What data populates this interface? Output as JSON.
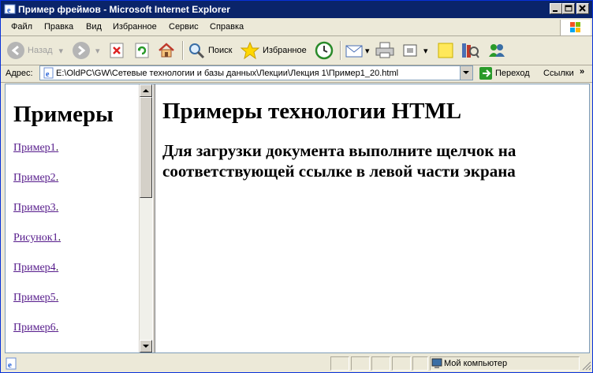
{
  "window": {
    "title": "Пример фреймов - Microsoft Internet Explorer"
  },
  "menu": {
    "items": [
      "Файл",
      "Правка",
      "Вид",
      "Избранное",
      "Сервис",
      "Справка"
    ],
    "accel": [
      "Ф",
      "П",
      "В",
      "И",
      "С",
      "С"
    ]
  },
  "toolbar": {
    "back_label": "Назад",
    "search_label": "Поиск",
    "favorites_label": "Избранное"
  },
  "address": {
    "label": "Адрес:",
    "url": "E:\\OldPC\\GW\\Сетевые технологии и базы данных\\Лекции\\Лекция 1\\Пример1_20.html",
    "go_label": "Переход",
    "links_label": "Ссылки"
  },
  "left_frame": {
    "heading": "Примеры",
    "links": [
      "Пример1",
      "Пример2",
      "Пример3",
      "Рисунок1",
      "Пример4",
      "Пример5",
      "Пример6"
    ],
    "link_color": "#551a8b"
  },
  "right_frame": {
    "heading": "Примеры технологии HTML",
    "subheading": "Для загрузки документа выполните щелчок на соответствующей ссылке в левой части экрана"
  },
  "status": {
    "zone": "Мой компьютер"
  },
  "colors": {
    "titlebar": "#0a246a",
    "chrome": "#ece9d8"
  }
}
